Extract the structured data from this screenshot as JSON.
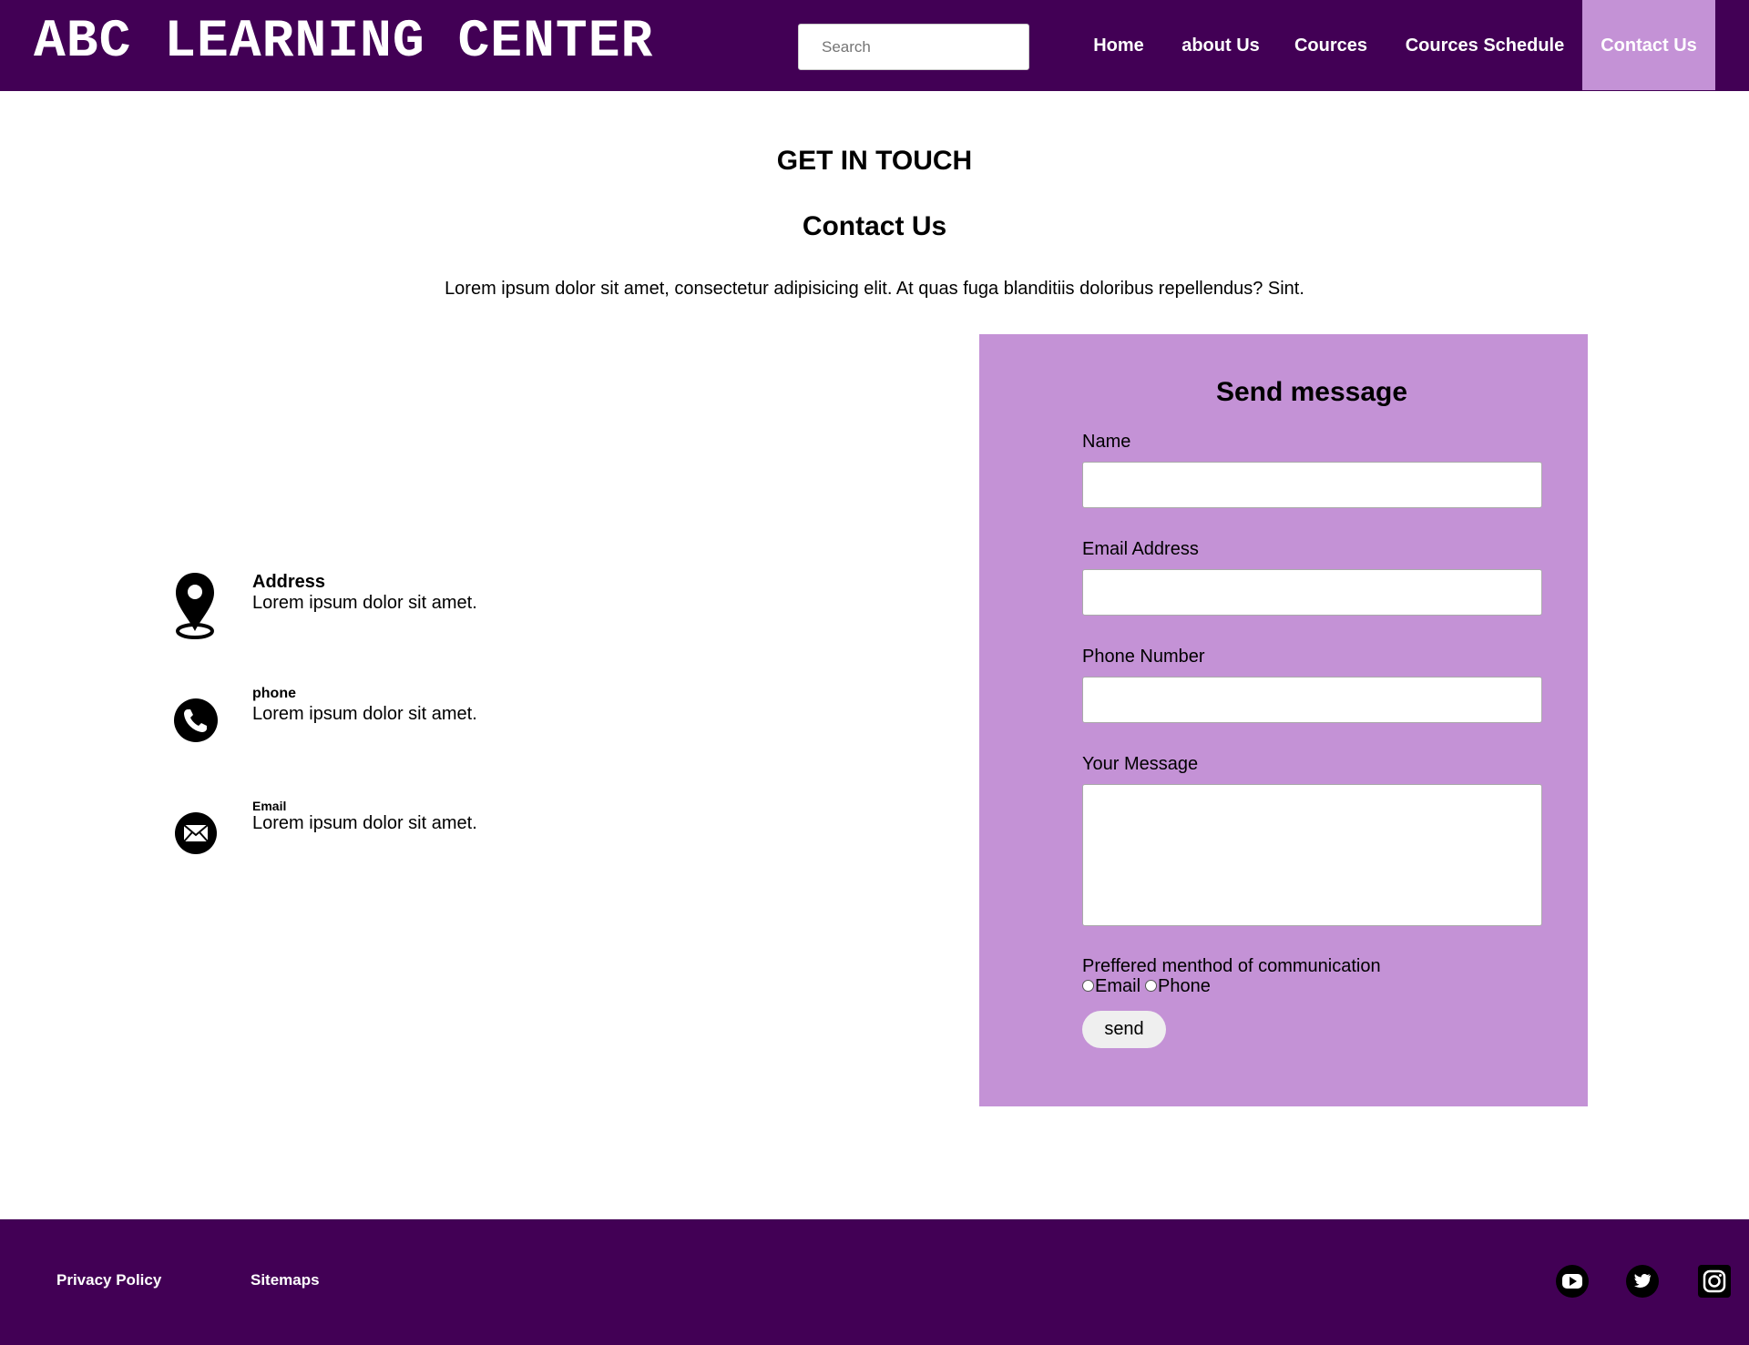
{
  "header": {
    "logo": "ABC LEARNING CENTER",
    "search_placeholder": "Search",
    "nav": [
      "Home",
      "about Us",
      "Cources",
      "Cources Schedule",
      "Contact Us"
    ],
    "active_nav": "Contact Us"
  },
  "intro": {
    "kicker": "GET IN TOUCH",
    "title": "Contact Us",
    "text": "Lorem ipsum dolor sit amet, consectetur adipisicing elit. At quas fuga blanditiis doloribus repellendus? Sint."
  },
  "info": [
    {
      "icon": "location-pin-icon",
      "title": "Address",
      "text": "Lorem ipsum dolor sit amet."
    },
    {
      "icon": "phone-icon",
      "title": "phone",
      "text": "Lorem ipsum dolor sit amet."
    },
    {
      "icon": "email-icon",
      "title": "Email",
      "text": "Lorem ipsum dolor sit amet."
    }
  ],
  "form": {
    "title": "Send message",
    "name_label": "Name",
    "email_label": "Email Address",
    "phone_label": "Phone Number",
    "message_label": "Your Message",
    "pref_label": "Preffered menthod of communication",
    "radio_email": "Email",
    "radio_phone": "Phone",
    "send_label": "send"
  },
  "footer": {
    "privacy": "Privacy Policy",
    "sitemaps": "Sitemaps",
    "social": [
      "youtube-icon",
      "twitter-icon",
      "instagram-icon"
    ]
  },
  "colors": {
    "brand": "#420055",
    "accent": "#c492d6"
  }
}
